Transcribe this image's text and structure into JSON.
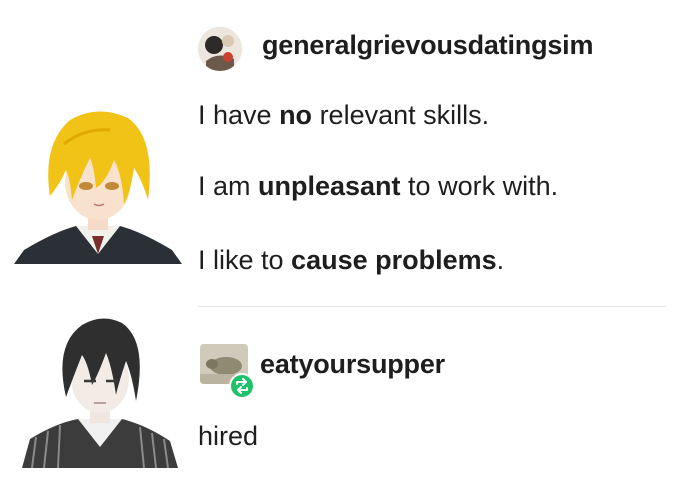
{
  "post": {
    "username": "generalgrievousdatingsim",
    "lines": [
      {
        "pre": "I have ",
        "bold": "no",
        "post": " relevant skills."
      },
      {
        "pre": "I am ",
        "bold": "unpleasant",
        "post": " to work with."
      },
      {
        "pre": "I like to ",
        "bold": "cause problems",
        "post": "."
      }
    ]
  },
  "reply": {
    "username": "eatyoursupper",
    "text": "hired"
  },
  "colors": {
    "text": "#1e1e1e",
    "reblog_badge": "#1fc16a",
    "blonde_hair": "#f2c317",
    "dark_hair": "#2f2f2f"
  },
  "icons": {
    "reblog": "reblog-icon"
  }
}
